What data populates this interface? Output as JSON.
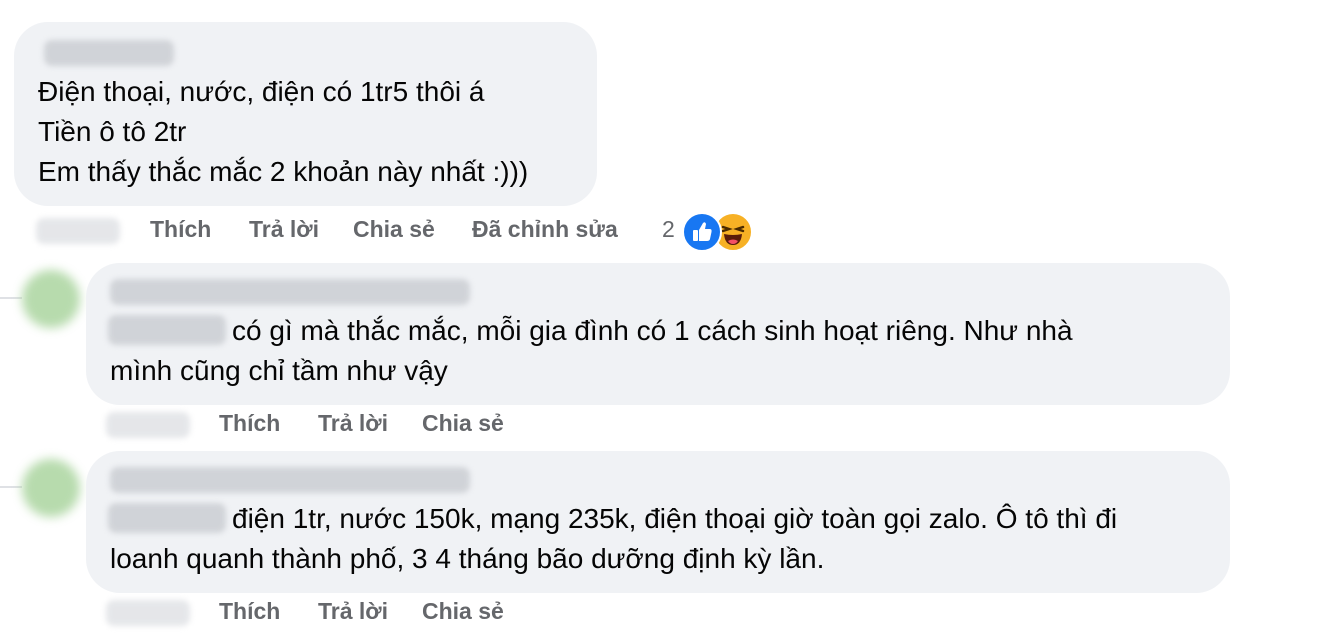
{
  "comments": [
    {
      "lines": [
        "Điện thoại, nước, điện có 1tr5 thôi á",
        "Tiền ô tô 2tr",
        "Em thấy thắc mắc 2 khoản này nhất :)))"
      ],
      "actions": {
        "like": "Thích",
        "reply": "Trả lời",
        "share": "Chia sẻ",
        "edited": "Đã chỉnh sửa"
      },
      "reaction_count": "2",
      "reactions": [
        "like-icon",
        "haha-icon"
      ]
    },
    {
      "lines": [
        "có gì mà thắc mắc, mỗi gia đình có 1 cách sinh hoạt riêng. Như nhà",
        "mình cũng chỉ tầm như vậy"
      ],
      "actions": {
        "like": "Thích",
        "reply": "Trả lời",
        "share": "Chia sẻ"
      }
    },
    {
      "lines": [
        "điện 1tr, nước 150k, mạng 235k, điện thoại giờ toàn gọi zalo. Ô tô thì đi",
        "loanh quanh thành phố, 3 4 tháng bão dưỡng định kỳ lần."
      ],
      "actions": {
        "like": "Thích",
        "reply": "Trả lời",
        "share": "Chia sẻ"
      }
    }
  ],
  "colors": {
    "bubble": "#f0f2f5",
    "action_text": "#65676b",
    "like_blue": "#1877f2",
    "haha_yellow": "#f7b125"
  }
}
